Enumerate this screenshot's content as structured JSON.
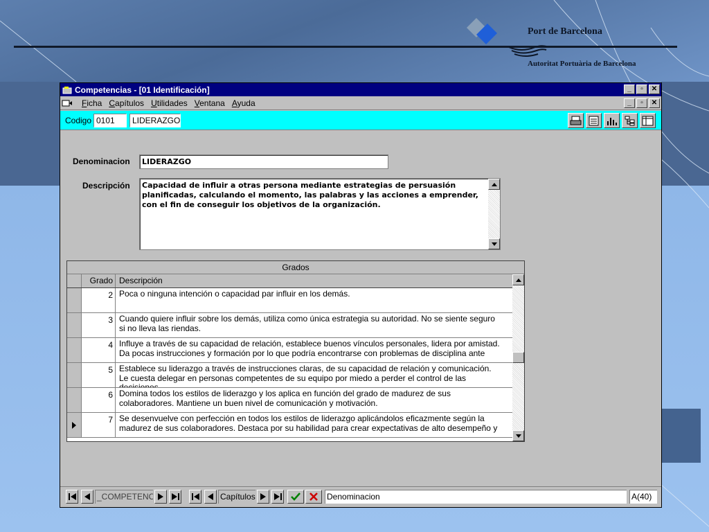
{
  "brand": {
    "title": "Port de Barcelona",
    "subtitle": "Autoritat Portuària de Barcelona"
  },
  "window": {
    "title": "Competencias - [01 Identificación]"
  },
  "menu": {
    "items": [
      "Ficha",
      "Capítulos",
      "Utilidades",
      "Ventana",
      "Ayuda"
    ],
    "mnemonics": [
      "F",
      "C",
      "U",
      "V",
      "A"
    ]
  },
  "toolbar": {
    "codigo_label": "Codigo",
    "codigo_value": "0101",
    "name_value": "LIDERAZGO",
    "icons": [
      "print-icon",
      "form-icon",
      "chart-icon",
      "tree-icon",
      "columns-icon"
    ]
  },
  "form": {
    "denominacion_label": "Denominacion",
    "denominacion_value": "LIDERAZGO",
    "descripcion_label": "Descripción",
    "descripcion_value": "Capacidad de influir a otras persona mediante estrategias de persuasión planificadas, calculando el momento, las palabras y las acciones a emprender, con el fin de conseguir los objetivos de la organización."
  },
  "grid": {
    "caption": "Grados",
    "columns": [
      "Grado",
      "Descripción"
    ],
    "rows": [
      {
        "grado": "2",
        "descripcion": "Poca o ninguna intención o capacidad par influir en los demás."
      },
      {
        "grado": "3",
        "descripcion": "Cuando quiere influir sobre los demás, utiliza como única estrategia su autoridad. No se siente seguro si no lleva las riendas."
      },
      {
        "grado": "4",
        "descripcion": "Influye a través de su capacidad de relación, establece buenos vínculos personales, lidera por amistad. Da pocas instrucciones y formación por lo que podría encontrarse con problemas de disciplina ante"
      },
      {
        "grado": "5",
        "descripcion": "Establece su liderazgo a través de instrucciones claras, de su capacidad de relación y comunicación. Le cuesta delegar en personas competentes de su equipo por miedo a perder el control de las decisiones."
      },
      {
        "grado": "6",
        "descripcion": "Domina todos los estilos de liderazgo y los aplica en función del grado de madurez de sus colaboradores. Mantiene un buen nivel de comunicación y motivación."
      },
      {
        "grado": "7",
        "descripcion": "Se desenvuelve con perfección en todos los estilos de liderazgo aplicándolos eficazmente según la madurez de sus colaboradores. Destaca por su habilidad para crear expectativas de alto desempeño y"
      }
    ]
  },
  "statusbar": {
    "table_field": "_COMPETENCI",
    "chapter_field": "Capítulos",
    "field_name": "Denominacion",
    "field_type": "A(40)"
  },
  "colors": {
    "titlebar": "#000080",
    "toolbar": "#00ffff",
    "confirm": "#008000",
    "cancel": "#cc0000"
  }
}
